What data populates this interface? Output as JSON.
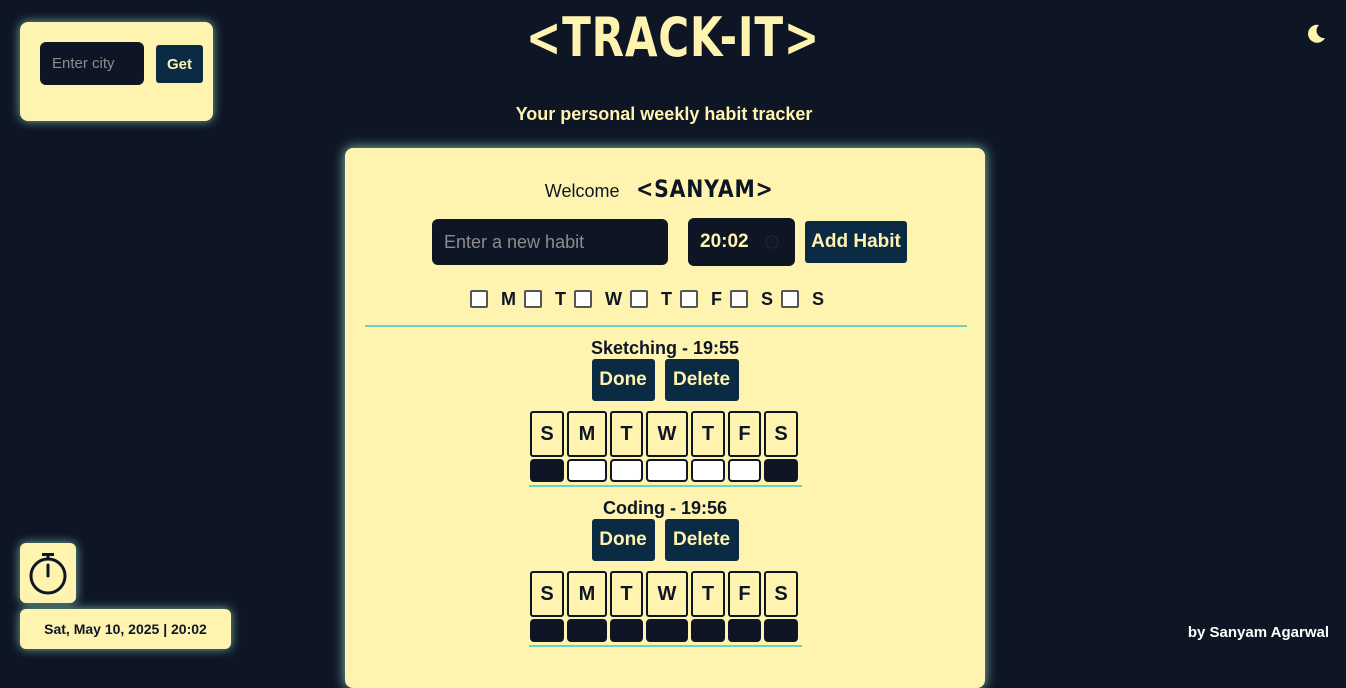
{
  "weather": {
    "city_placeholder": "Enter city",
    "get_label": "Get"
  },
  "theme_toggle_icon": "moon-icon",
  "header": {
    "logo": "<TRACK-IT>",
    "subtitle": "Your personal weekly habit tracker"
  },
  "card": {
    "welcome_text": "Welcome",
    "user_name": "<SANYAM>",
    "habit_placeholder": "Enter a new habit",
    "time_value": "20:02",
    "add_label": "Add Habit",
    "day_options": [
      "M",
      "T",
      "W",
      "T",
      "F",
      "S",
      "S"
    ]
  },
  "habits": [
    {
      "title": "Sketching - 19:55",
      "done_label": "Done",
      "delete_label": "Delete",
      "days": [
        "S",
        "M",
        "T",
        "W",
        "T",
        "F",
        "S"
      ],
      "completed": [
        true,
        false,
        false,
        false,
        false,
        false,
        true
      ]
    },
    {
      "title": "Coding - 19:56",
      "done_label": "Done",
      "delete_label": "Delete",
      "days": [
        "S",
        "M",
        "T",
        "W",
        "T",
        "F",
        "S"
      ],
      "completed": [
        true,
        true,
        true,
        true,
        true,
        true,
        true
      ]
    }
  ],
  "footer": {
    "timer_icon": "stopwatch-icon",
    "datetime": "Sat, May 10, 2025 | 20:02",
    "credit": "by Sanyam Agarwal"
  },
  "colors": {
    "background": "#0e1626",
    "panel": "#fff3b0",
    "button": "#0b2b44",
    "accent_glow": "#a0f0d2"
  }
}
